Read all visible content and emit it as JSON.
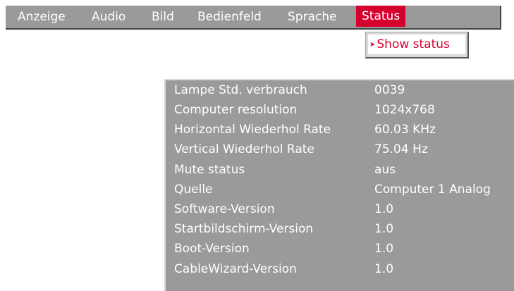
{
  "menu": {
    "items": [
      {
        "label": "Anzeige",
        "active": false
      },
      {
        "label": "Audio",
        "active": false
      },
      {
        "label": "Bild",
        "active": false
      },
      {
        "label": "Bedienfeld",
        "active": false
      },
      {
        "label": "Sprache",
        "active": false
      },
      {
        "label": "Status",
        "active": true
      }
    ]
  },
  "submenu": {
    "arrow": "➤",
    "label": "Show status"
  },
  "status": {
    "rows": [
      {
        "label": "Lampe Std. verbrauch",
        "value": "0039"
      },
      {
        "label": "Computer resolution",
        "value": "1024x768"
      },
      {
        "label": "Horizontal Wiederhol Rate",
        "value": "60.03 KHz"
      },
      {
        "label": "Vertical Wiederhol Rate",
        "value": "75.04 Hz"
      },
      {
        "label": "Mute status",
        "value": "aus"
      },
      {
        "label": "Quelle",
        "value": "Computer 1 Analog"
      },
      {
        "label": "Software-Version",
        "value": "1.0"
      },
      {
        "label": "Startbildschirm-Version",
        "value": "1.0"
      },
      {
        "label": "Boot-Version",
        "value": "1.0"
      },
      {
        "label": "CableWizard-Version",
        "value": "1.0"
      }
    ]
  },
  "colors": {
    "menu_bg": "#9a9a9a",
    "accent": "#d6002e",
    "text": "#ffffff",
    "submenu_bg": "#ffffff"
  }
}
